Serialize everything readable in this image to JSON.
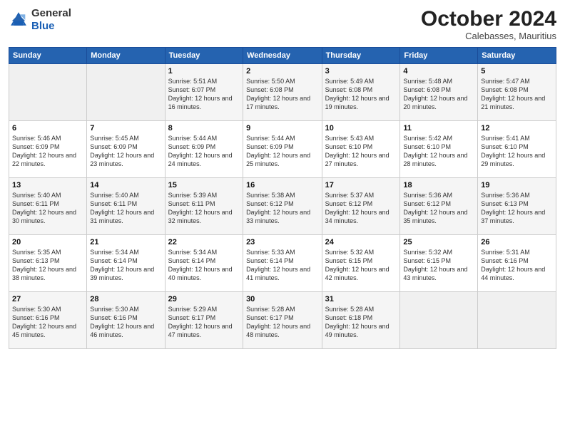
{
  "header": {
    "logo_general": "General",
    "logo_blue": "Blue",
    "month": "October 2024",
    "location": "Calebasses, Mauritius"
  },
  "weekdays": [
    "Sunday",
    "Monday",
    "Tuesday",
    "Wednesday",
    "Thursday",
    "Friday",
    "Saturday"
  ],
  "weeks": [
    [
      {
        "day": "",
        "sunrise": "",
        "sunset": "",
        "daylight": ""
      },
      {
        "day": "",
        "sunrise": "",
        "sunset": "",
        "daylight": ""
      },
      {
        "day": "1",
        "sunrise": "Sunrise: 5:51 AM",
        "sunset": "Sunset: 6:07 PM",
        "daylight": "Daylight: 12 hours and 16 minutes."
      },
      {
        "day": "2",
        "sunrise": "Sunrise: 5:50 AM",
        "sunset": "Sunset: 6:08 PM",
        "daylight": "Daylight: 12 hours and 17 minutes."
      },
      {
        "day": "3",
        "sunrise": "Sunrise: 5:49 AM",
        "sunset": "Sunset: 6:08 PM",
        "daylight": "Daylight: 12 hours and 19 minutes."
      },
      {
        "day": "4",
        "sunrise": "Sunrise: 5:48 AM",
        "sunset": "Sunset: 6:08 PM",
        "daylight": "Daylight: 12 hours and 20 minutes."
      },
      {
        "day": "5",
        "sunrise": "Sunrise: 5:47 AM",
        "sunset": "Sunset: 6:08 PM",
        "daylight": "Daylight: 12 hours and 21 minutes."
      }
    ],
    [
      {
        "day": "6",
        "sunrise": "Sunrise: 5:46 AM",
        "sunset": "Sunset: 6:09 PM",
        "daylight": "Daylight: 12 hours and 22 minutes."
      },
      {
        "day": "7",
        "sunrise": "Sunrise: 5:45 AM",
        "sunset": "Sunset: 6:09 PM",
        "daylight": "Daylight: 12 hours and 23 minutes."
      },
      {
        "day": "8",
        "sunrise": "Sunrise: 5:44 AM",
        "sunset": "Sunset: 6:09 PM",
        "daylight": "Daylight: 12 hours and 24 minutes."
      },
      {
        "day": "9",
        "sunrise": "Sunrise: 5:44 AM",
        "sunset": "Sunset: 6:09 PM",
        "daylight": "Daylight: 12 hours and 25 minutes."
      },
      {
        "day": "10",
        "sunrise": "Sunrise: 5:43 AM",
        "sunset": "Sunset: 6:10 PM",
        "daylight": "Daylight: 12 hours and 27 minutes."
      },
      {
        "day": "11",
        "sunrise": "Sunrise: 5:42 AM",
        "sunset": "Sunset: 6:10 PM",
        "daylight": "Daylight: 12 hours and 28 minutes."
      },
      {
        "day": "12",
        "sunrise": "Sunrise: 5:41 AM",
        "sunset": "Sunset: 6:10 PM",
        "daylight": "Daylight: 12 hours and 29 minutes."
      }
    ],
    [
      {
        "day": "13",
        "sunrise": "Sunrise: 5:40 AM",
        "sunset": "Sunset: 6:11 PM",
        "daylight": "Daylight: 12 hours and 30 minutes."
      },
      {
        "day": "14",
        "sunrise": "Sunrise: 5:40 AM",
        "sunset": "Sunset: 6:11 PM",
        "daylight": "Daylight: 12 hours and 31 minutes."
      },
      {
        "day": "15",
        "sunrise": "Sunrise: 5:39 AM",
        "sunset": "Sunset: 6:11 PM",
        "daylight": "Daylight: 12 hours and 32 minutes."
      },
      {
        "day": "16",
        "sunrise": "Sunrise: 5:38 AM",
        "sunset": "Sunset: 6:12 PM",
        "daylight": "Daylight: 12 hours and 33 minutes."
      },
      {
        "day": "17",
        "sunrise": "Sunrise: 5:37 AM",
        "sunset": "Sunset: 6:12 PM",
        "daylight": "Daylight: 12 hours and 34 minutes."
      },
      {
        "day": "18",
        "sunrise": "Sunrise: 5:36 AM",
        "sunset": "Sunset: 6:12 PM",
        "daylight": "Daylight: 12 hours and 35 minutes."
      },
      {
        "day": "19",
        "sunrise": "Sunrise: 5:36 AM",
        "sunset": "Sunset: 6:13 PM",
        "daylight": "Daylight: 12 hours and 37 minutes."
      }
    ],
    [
      {
        "day": "20",
        "sunrise": "Sunrise: 5:35 AM",
        "sunset": "Sunset: 6:13 PM",
        "daylight": "Daylight: 12 hours and 38 minutes."
      },
      {
        "day": "21",
        "sunrise": "Sunrise: 5:34 AM",
        "sunset": "Sunset: 6:14 PM",
        "daylight": "Daylight: 12 hours and 39 minutes."
      },
      {
        "day": "22",
        "sunrise": "Sunrise: 5:34 AM",
        "sunset": "Sunset: 6:14 PM",
        "daylight": "Daylight: 12 hours and 40 minutes."
      },
      {
        "day": "23",
        "sunrise": "Sunrise: 5:33 AM",
        "sunset": "Sunset: 6:14 PM",
        "daylight": "Daylight: 12 hours and 41 minutes."
      },
      {
        "day": "24",
        "sunrise": "Sunrise: 5:32 AM",
        "sunset": "Sunset: 6:15 PM",
        "daylight": "Daylight: 12 hours and 42 minutes."
      },
      {
        "day": "25",
        "sunrise": "Sunrise: 5:32 AM",
        "sunset": "Sunset: 6:15 PM",
        "daylight": "Daylight: 12 hours and 43 minutes."
      },
      {
        "day": "26",
        "sunrise": "Sunrise: 5:31 AM",
        "sunset": "Sunset: 6:16 PM",
        "daylight": "Daylight: 12 hours and 44 minutes."
      }
    ],
    [
      {
        "day": "27",
        "sunrise": "Sunrise: 5:30 AM",
        "sunset": "Sunset: 6:16 PM",
        "daylight": "Daylight: 12 hours and 45 minutes."
      },
      {
        "day": "28",
        "sunrise": "Sunrise: 5:30 AM",
        "sunset": "Sunset: 6:16 PM",
        "daylight": "Daylight: 12 hours and 46 minutes."
      },
      {
        "day": "29",
        "sunrise": "Sunrise: 5:29 AM",
        "sunset": "Sunset: 6:17 PM",
        "daylight": "Daylight: 12 hours and 47 minutes."
      },
      {
        "day": "30",
        "sunrise": "Sunrise: 5:28 AM",
        "sunset": "Sunset: 6:17 PM",
        "daylight": "Daylight: 12 hours and 48 minutes."
      },
      {
        "day": "31",
        "sunrise": "Sunrise: 5:28 AM",
        "sunset": "Sunset: 6:18 PM",
        "daylight": "Daylight: 12 hours and 49 minutes."
      },
      {
        "day": "",
        "sunrise": "",
        "sunset": "",
        "daylight": ""
      },
      {
        "day": "",
        "sunrise": "",
        "sunset": "",
        "daylight": ""
      }
    ]
  ]
}
